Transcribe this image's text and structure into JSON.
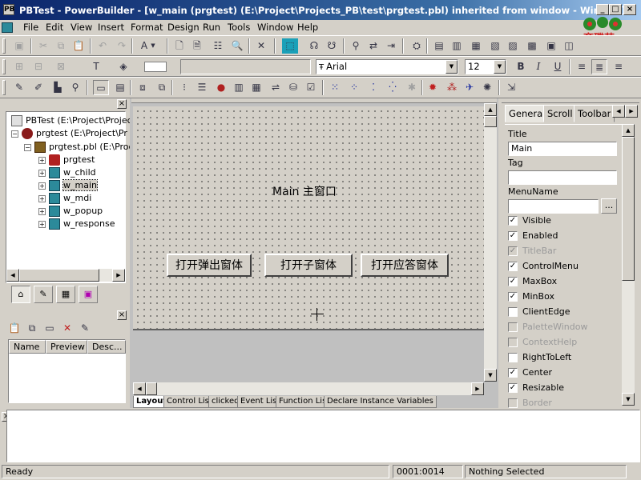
{
  "window": {
    "title": "PBTest - PowerBuilder - [w_main (prgtest) (E:\\Project\\Projects_PB\\test\\prgtest.pbl) inherited from window - Window]",
    "app_icon": "pb-icon",
    "minimize": "_",
    "restore": "□",
    "close": "×",
    "watermark_text": "育碟苑"
  },
  "menu": [
    "File",
    "Edit",
    "View",
    "Insert",
    "Format",
    "Design",
    "Run",
    "Tools",
    "Window",
    "Help"
  ],
  "format_toolbar": {
    "font_name": "Arial",
    "font_size": "12",
    "bold": "B",
    "italic": "I",
    "underline": "U"
  },
  "tree": {
    "items": [
      {
        "label": "PBTest (E:\\Project\\Projec",
        "level": 0,
        "icon": "workspace-icon"
      },
      {
        "label": "prgtest (E:\\Project\\Pr",
        "level": 1,
        "icon": "target-icon"
      },
      {
        "label": "prgtest.pbl (E:\\Proc",
        "level": 2,
        "icon": "library-icon"
      },
      {
        "label": "prgtest",
        "level": 3,
        "icon": "application-icon"
      },
      {
        "label": "w_child",
        "level": 3,
        "icon": "window-icon"
      },
      {
        "label": "w_main",
        "level": 3,
        "icon": "window-icon",
        "selected": true
      },
      {
        "label": "w_mdi",
        "level": 3,
        "icon": "window-icon"
      },
      {
        "label": "w_popup",
        "level": 3,
        "icon": "window-icon"
      },
      {
        "label": "w_response",
        "level": 3,
        "icon": "window-icon"
      }
    ]
  },
  "list_view": {
    "columns": [
      "Name",
      "Preview",
      "Desc..."
    ]
  },
  "design": {
    "window_title": "Main 主窗口",
    "buttons": [
      "打开弹出窗体",
      "打开子窗体",
      "打开应答窗体"
    ]
  },
  "bottom_tabs": [
    "Layout",
    "Control List",
    "clicked",
    "Event List",
    "Function List",
    "Declare Instance Variables"
  ],
  "properties": {
    "tabs": [
      "General",
      "Scroll",
      "Toolbar"
    ],
    "title_label": "Title",
    "title_value": "Main",
    "tag_label": "Tag",
    "tag_value": "",
    "menuname_label": "MenuName",
    "menuname_value": "",
    "browse": "...",
    "checks": [
      {
        "label": "Visible",
        "checked": true,
        "enabled": true
      },
      {
        "label": "Enabled",
        "checked": true,
        "enabled": true
      },
      {
        "label": "TitleBar",
        "checked": true,
        "enabled": false
      },
      {
        "label": "ControlMenu",
        "checked": true,
        "enabled": true
      },
      {
        "label": "MaxBox",
        "checked": true,
        "enabled": true
      },
      {
        "label": "MinBox",
        "checked": true,
        "enabled": true
      },
      {
        "label": "ClientEdge",
        "checked": false,
        "enabled": true
      },
      {
        "label": "PaletteWindow",
        "checked": false,
        "enabled": false
      },
      {
        "label": "ContextHelp",
        "checked": false,
        "enabled": false
      },
      {
        "label": "RightToLeft",
        "checked": false,
        "enabled": true
      },
      {
        "label": "Center",
        "checked": true,
        "enabled": true
      },
      {
        "label": "Resizable",
        "checked": true,
        "enabled": true
      },
      {
        "label": "Border",
        "checked": false,
        "enabled": false
      }
    ]
  },
  "status": {
    "message": "Ready",
    "position": "0001:0014",
    "selection": "Nothing Selected"
  }
}
